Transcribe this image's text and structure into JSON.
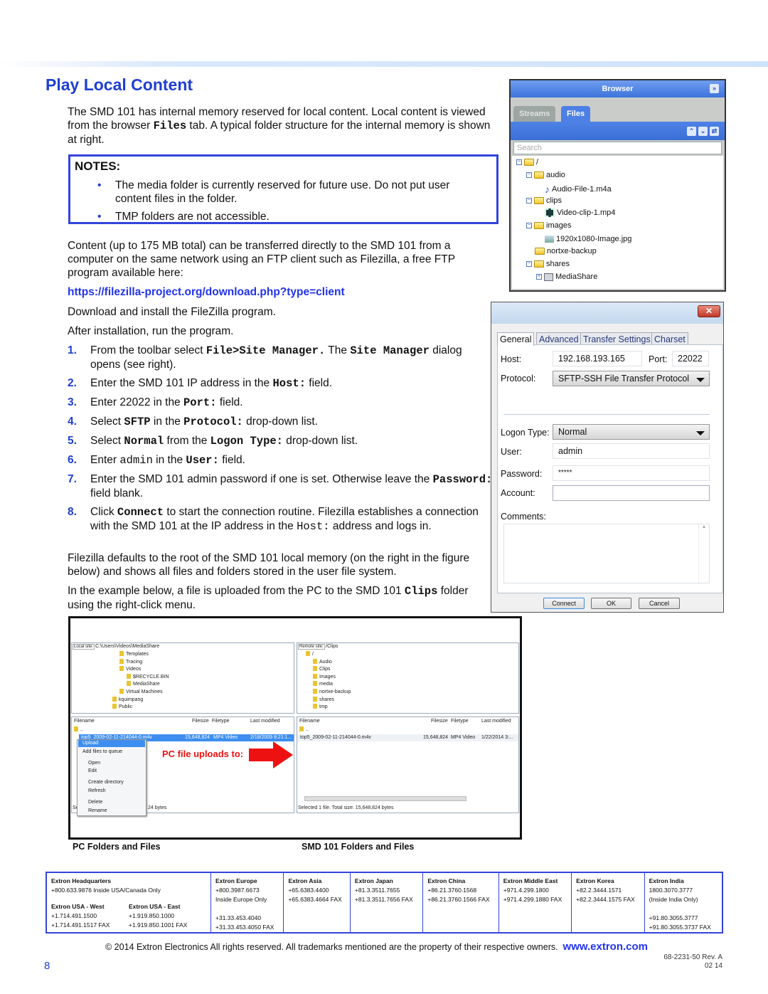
{
  "page": {
    "title": "Play Local Content",
    "page_number": "8",
    "doc_number": "68-2231-50 Rev. A",
    "doc_date": "02 14",
    "accent": "#1f3fd0"
  },
  "intro": [
    {
      "t": "The SMD 101 has internal memory reserved for local content. Local content is viewed from the browser "
    },
    {
      "t": "Files",
      "m": "bm"
    },
    {
      "t": " tab. A typical folder structure for the internal memory is shown at right."
    }
  ],
  "notes": {
    "heading": "NOTES:",
    "items": [
      "The media folder is currently reserved for future use. Do not put user content files in the folder.",
      "TMP folders are not accessible."
    ]
  },
  "para2": "Content (up to 175 MB total) can be transferred directly to the SMD 101 from a computer on the same network using an FTP client such as Filezilla, a free FTP program available here:",
  "link": "https://filezilla-project.org/download.php?type=client",
  "para3": "Download and install the FileZilla program.",
  "para4": "After installation, run the program.",
  "steps": [
    {
      "n": "1.",
      "s": [
        {
          "t": "From the toolbar select "
        },
        {
          "t": "File>Site Manager.",
          "m": "bm"
        },
        {
          "t": " The "
        },
        {
          "t": "Site Manager",
          "m": "bm"
        },
        {
          "t": " dialog opens (see right)."
        }
      ]
    },
    {
      "n": "2.",
      "s": [
        {
          "t": "Enter the SMD 101 IP address in the "
        },
        {
          "t": "Host:",
          "m": "bm"
        },
        {
          "t": " field."
        }
      ]
    },
    {
      "n": "3.",
      "s": [
        {
          "t": "Enter 22022 in the "
        },
        {
          "t": "Port:",
          "m": "bm"
        },
        {
          "t": " field."
        }
      ]
    },
    {
      "n": "4.",
      "s": [
        {
          "t": "Select "
        },
        {
          "t": "SFTP",
          "m": "bm"
        },
        {
          "t": " in the "
        },
        {
          "t": "Protocol:",
          "m": "bm"
        },
        {
          "t": " drop-down list."
        }
      ]
    },
    {
      "n": "5.",
      "s": [
        {
          "t": "Select "
        },
        {
          "t": "Normal",
          "m": "bm"
        },
        {
          "t": " from the "
        },
        {
          "t": "Logon Type:",
          "m": "bm"
        },
        {
          "t": " drop-down list."
        }
      ]
    },
    {
      "n": "6.",
      "s": [
        {
          "t": "Enter "
        },
        {
          "t": "admin",
          "m": "m"
        },
        {
          "t": " in the "
        },
        {
          "t": "User:",
          "m": "bm"
        },
        {
          "t": " field."
        }
      ]
    },
    {
      "n": "7.",
      "s": [
        {
          "t": "Enter the SMD 101 admin password if one is set. Otherwise leave the "
        },
        {
          "t": "Password:",
          "m": "bm"
        },
        {
          "t": " field blank."
        }
      ]
    },
    {
      "n": "8.",
      "s": [
        {
          "t": "Click "
        },
        {
          "t": "Connect",
          "m": "bm"
        },
        {
          "t": " to start the connection routine. Filezilla establishes a connection with the SMD 101 at the IP address in the "
        },
        {
          "t": "Host:",
          "m": "m"
        },
        {
          "t": " address and logs in."
        }
      ]
    }
  ],
  "para5": "Filezilla defaults to the root of the SMD 101 local memory (on the right in the figure below) and shows all files and folders stored in the user file system.",
  "para6": [
    {
      "t": "In the example below, a file is uploaded from the PC to the SMD 101 "
    },
    {
      "t": "Clips",
      "m": "bm"
    },
    {
      "t": " folder using the right-click menu."
    }
  ],
  "browser": {
    "title": "Browser",
    "tabs": [
      "Streams",
      "Files"
    ],
    "active_tab": "Files",
    "search_placeholder": "Search",
    "tree": [
      "/",
      "audio",
      "Audio-File-1.m4a",
      "clips",
      "Video-clip-1.mp4",
      "images",
      "1920x1080-Image.jpg",
      "nortxe-backup",
      "shares",
      "MediaShare"
    ]
  },
  "site_manager": {
    "tabs": [
      "General",
      "Advanced",
      "Transfer Settings",
      "Charset"
    ],
    "host_label": "Host:",
    "host": "192.168.193.165",
    "port_label": "Port:",
    "port": "22022",
    "protocol_label": "Protocol:",
    "protocol": "SFTP-SSH File Transfer Protocol",
    "logon_label": "Logon Type:",
    "logon": "Normal",
    "user_label": "User:",
    "user": "admin",
    "password_label": "Password:",
    "password": "*****",
    "account_label": "Account:",
    "comments_label": "Comments:",
    "buttons": [
      "Connect",
      "OK",
      "Cancel"
    ]
  },
  "filezilla": {
    "local": {
      "label": "Local site:",
      "path": "C:\\Users\\Videos\\MediaShare",
      "tree": [
        "Templates",
        "Tracing",
        "Videos",
        "$RECYCLE.BIN",
        "MediaShare",
        "Virtual Machines",
        "kquimpang",
        "Public"
      ],
      "cols": [
        "Filename",
        "Filesize",
        "Filetype",
        "Last modified"
      ],
      "row": {
        "name": "top5_2009-02-11-214044-0.m4v",
        "size": "15,648,824",
        "type": "MP4 Video",
        "modified": "2/18/2009 8:21:1..."
      },
      "status_a": "Se",
      "status_b": "24 bytes"
    },
    "menu": [
      "Upload",
      "Add files to queue",
      "Open",
      "Edit",
      "Create directory",
      "Refresh",
      "Delete",
      "Rename"
    ],
    "callout": "PC file uploads to:",
    "remote": {
      "label": "Remote site:",
      "path": "/Clips",
      "tree": [
        "/",
        "Audio",
        "Clips",
        "Images",
        "media",
        "nortxe-backup",
        "shares",
        "tmp"
      ],
      "cols": [
        "Filename",
        "Filesize",
        "Filetype",
        "Last modified"
      ],
      "row": {
        "name": "top5_2009-02-11-214044-0.m4v",
        "size": "15,648,824",
        "type": "MP4 Video",
        "modified": "1/22/2014 3:..."
      },
      "status": "Selected 1 file. Total size: 15,648,824 bytes"
    },
    "caption_left": "PC Folders and Files",
    "caption_right": "SMD 101 Folders and Files"
  },
  "footer": {
    "offices": [
      {
        "name": "Extron Headquarters",
        "lines": [
          "+800.633.9876 Inside USA/Canada Only"
        ],
        "sub": [
          {
            "name": "Extron USA - West",
            "lines": [
              "+1.714.491.1500",
              "+1.714.491.1517 FAX"
            ]
          },
          {
            "name": "Extron USA - East",
            "lines": [
              "+1.919.850.1000",
              "+1.919.850.1001 FAX"
            ]
          }
        ]
      },
      {
        "name": "Extron Europe",
        "lines": [
          "+800.3987.6673",
          "Inside Europe Only",
          "",
          "+31.33.453.4040",
          "+31.33.453.4050 FAX"
        ]
      },
      {
        "name": "Extron Asia",
        "lines": [
          "+65.6383.4400",
          "+65.6383.4664 FAX"
        ]
      },
      {
        "name": "Extron Japan",
        "lines": [
          "+81.3.3511.7655",
          "+81.3.3511.7656 FAX"
        ]
      },
      {
        "name": "Extron China",
        "lines": [
          "+86.21.3760.1568",
          "+86.21.3760.1566 FAX"
        ]
      },
      {
        "name": "Extron Middle East",
        "lines": [
          "+971.4.299.1800",
          "+971.4.299.1880 FAX"
        ]
      },
      {
        "name": "Extron Korea",
        "lines": [
          "+82.2.3444.1571",
          "+82.2.3444.1575 FAX"
        ]
      },
      {
        "name": "Extron India",
        "lines": [
          "1800.3070.3777",
          "(Inside India Only)",
          "",
          "+91.80.3055.3777",
          "+91.80.3055.3737 FAX"
        ]
      }
    ],
    "copyright": "© 2014 Extron Electronics   All rights reserved.  All trademarks mentioned are the property of their respective owners.",
    "website": "www.extron.com"
  }
}
